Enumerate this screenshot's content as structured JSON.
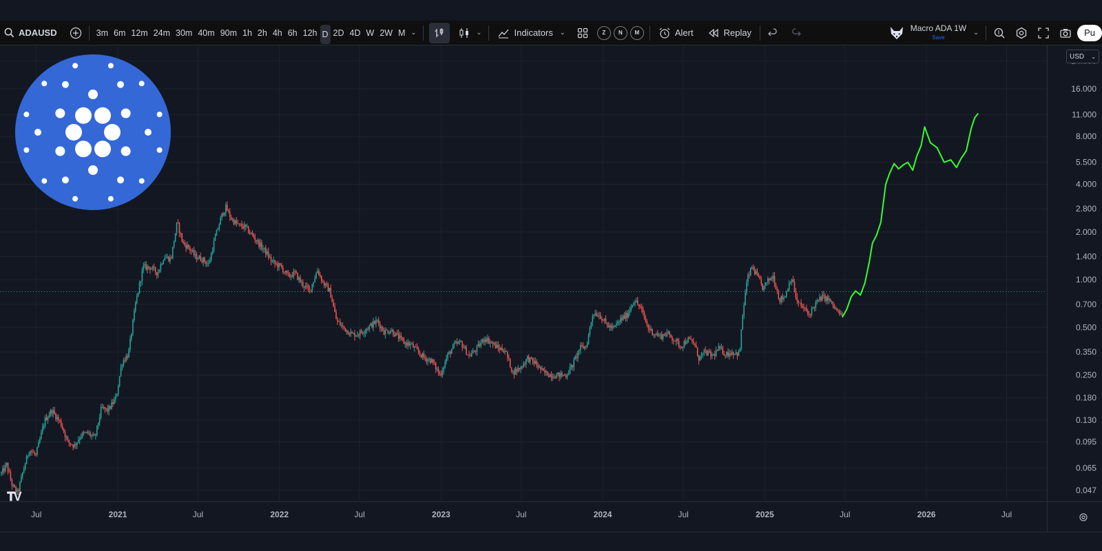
{
  "toolbar": {
    "symbol": "ADAUSD",
    "timeframes": [
      {
        "label": "3m",
        "active": false
      },
      {
        "label": "6m",
        "active": false
      },
      {
        "label": "12m",
        "active": false
      },
      {
        "label": "24m",
        "active": false
      },
      {
        "label": "30m",
        "active": false
      },
      {
        "label": "40m",
        "active": false
      },
      {
        "label": "90m",
        "active": false
      },
      {
        "label": "1h",
        "active": false
      },
      {
        "label": "2h",
        "active": false
      },
      {
        "label": "4h",
        "active": false
      },
      {
        "label": "6h",
        "active": false
      },
      {
        "label": "12h",
        "active": false
      },
      {
        "label": "D",
        "active": true
      },
      {
        "label": "2D",
        "active": false
      },
      {
        "label": "4D",
        "active": false
      },
      {
        "label": "W",
        "active": false
      },
      {
        "label": "2W",
        "active": false
      },
      {
        "label": "M",
        "active": false
      }
    ],
    "indicators_label": "Indicators",
    "session_buttons": [
      "Z",
      "N",
      "M"
    ],
    "alert_label": "Alert",
    "replay_label": "Replay",
    "layout_name": "Macro ADA 1W",
    "layout_save": "Save",
    "publish_label": "Pu"
  },
  "currency": "USD",
  "colors": {
    "background": "#131722",
    "toolbar": "#0f0f0f",
    "grid": "#1e222d",
    "up": "#26a69a",
    "down": "#ef5350",
    "projection": "#33ff33",
    "price_line": "#26a69a",
    "logo_blue": "#3468d6"
  },
  "icons": {
    "search": "search-icon",
    "compare": "add-circle-icon",
    "chart_type": "candles-icon",
    "indicators": "indicators-icon",
    "templates": "grid-icon",
    "alert": "alarm-clock-icon",
    "replay": "rewind-icon",
    "undo": "undo-icon",
    "redo": "redo-icon",
    "avatar": "fox-avatar-icon",
    "zoom": "magnifier-icon",
    "settings": "gear-icon",
    "fullscreen": "fullscreen-icon",
    "snapshot": "camera-icon",
    "cardano_logo": "cardano-logo-icon",
    "tradingview_logo": "tradingview-logo-icon"
  },
  "chart_data": {
    "type": "line",
    "y_scale": "log",
    "ylim": [
      0.04,
      30
    ],
    "xlim": [
      "2020-04-10",
      "2026-09-30"
    ],
    "y_ticks": [
      "24.000",
      "16.000",
      "11.000",
      "8.000",
      "5.500",
      "4.000",
      "2.800",
      "2.000",
      "1.400",
      "1.000",
      "0.700",
      "0.500",
      "0.350",
      "0.250",
      "0.180",
      "0.130",
      "0.095",
      "0.065",
      "0.047"
    ],
    "x_ticks": [
      {
        "date": "2020-07-01",
        "label": "Jul"
      },
      {
        "date": "2021-01-01",
        "label": "2021"
      },
      {
        "date": "2021-07-01",
        "label": "Jul"
      },
      {
        "date": "2022-01-01",
        "label": "2022"
      },
      {
        "date": "2022-07-01",
        "label": "Jul"
      },
      {
        "date": "2023-01-01",
        "label": "2023"
      },
      {
        "date": "2023-07-01",
        "label": "Jul"
      },
      {
        "date": "2024-01-01",
        "label": "2024"
      },
      {
        "date": "2024-07-01",
        "label": "Jul"
      },
      {
        "date": "2025-01-01",
        "label": "2025"
      },
      {
        "date": "2025-07-01",
        "label": "Jul"
      },
      {
        "date": "2026-01-01",
        "label": "2026"
      },
      {
        "date": "2026-07-01",
        "label": "Jul"
      }
    ],
    "price_line": 0.84,
    "series": [
      {
        "name": "ADAUSD",
        "style": "candles",
        "points": [
          [
            "2020-04-13",
            0.06
          ],
          [
            "2020-04-25",
            0.068
          ],
          [
            "2020-05-08",
            0.05
          ],
          [
            "2020-05-20",
            0.045
          ],
          [
            "2020-06-01",
            0.062
          ],
          [
            "2020-06-15",
            0.085
          ],
          [
            "2020-06-30",
            0.078
          ],
          [
            "2020-07-20",
            0.13
          ],
          [
            "2020-08-05",
            0.15
          ],
          [
            "2020-08-25",
            0.125
          ],
          [
            "2020-09-10",
            0.095
          ],
          [
            "2020-09-25",
            0.09
          ],
          [
            "2020-10-10",
            0.105
          ],
          [
            "2020-10-25",
            0.108
          ],
          [
            "2020-11-10",
            0.1
          ],
          [
            "2020-11-25",
            0.155
          ],
          [
            "2020-12-10",
            0.15
          ],
          [
            "2020-12-28",
            0.18
          ],
          [
            "2021-01-10",
            0.3
          ],
          [
            "2021-01-25",
            0.34
          ],
          [
            "2021-02-10",
            0.7
          ],
          [
            "2021-02-27",
            1.2
          ],
          [
            "2021-03-15",
            1.2
          ],
          [
            "2021-04-01",
            1.1
          ],
          [
            "2021-04-15",
            1.4
          ],
          [
            "2021-05-01",
            1.35
          ],
          [
            "2021-05-15",
            2.3
          ],
          [
            "2021-05-28",
            1.7
          ],
          [
            "2021-06-10",
            1.6
          ],
          [
            "2021-06-25",
            1.4
          ],
          [
            "2021-07-10",
            1.35
          ],
          [
            "2021-07-25",
            1.25
          ],
          [
            "2021-08-10",
            1.9
          ],
          [
            "2021-08-25",
            2.6
          ],
          [
            "2021-09-02",
            2.85
          ],
          [
            "2021-09-15",
            2.4
          ],
          [
            "2021-10-01",
            2.2
          ],
          [
            "2021-10-15",
            2.15
          ],
          [
            "2021-11-01",
            1.9
          ],
          [
            "2021-11-15",
            1.7
          ],
          [
            "2021-12-01",
            1.5
          ],
          [
            "2021-12-15",
            1.3
          ],
          [
            "2022-01-05",
            1.2
          ],
          [
            "2022-01-20",
            1.05
          ],
          [
            "2022-02-05",
            1.1
          ],
          [
            "2022-02-20",
            0.95
          ],
          [
            "2022-03-10",
            0.85
          ],
          [
            "2022-03-28",
            1.15
          ],
          [
            "2022-04-10",
            0.95
          ],
          [
            "2022-04-25",
            0.85
          ],
          [
            "2022-05-10",
            0.55
          ],
          [
            "2022-05-25",
            0.5
          ],
          [
            "2022-06-15",
            0.45
          ],
          [
            "2022-07-01",
            0.46
          ],
          [
            "2022-07-20",
            0.5
          ],
          [
            "2022-08-10",
            0.55
          ],
          [
            "2022-08-25",
            0.47
          ],
          [
            "2022-09-10",
            0.48
          ],
          [
            "2022-09-25",
            0.44
          ],
          [
            "2022-10-10",
            0.4
          ],
          [
            "2022-10-25",
            0.39
          ],
          [
            "2022-11-10",
            0.35
          ],
          [
            "2022-11-25",
            0.32
          ],
          [
            "2022-12-10",
            0.31
          ],
          [
            "2022-12-30",
            0.25
          ],
          [
            "2023-01-15",
            0.33
          ],
          [
            "2023-02-01",
            0.39
          ],
          [
            "2023-02-15",
            0.4
          ],
          [
            "2023-03-05",
            0.33
          ],
          [
            "2023-03-20",
            0.36
          ],
          [
            "2023-04-10",
            0.43
          ],
          [
            "2023-04-25",
            0.4
          ],
          [
            "2023-05-10",
            0.37
          ],
          [
            "2023-05-25",
            0.36
          ],
          [
            "2023-06-12",
            0.26
          ],
          [
            "2023-06-30",
            0.28
          ],
          [
            "2023-07-15",
            0.32
          ],
          [
            "2023-08-01",
            0.3
          ],
          [
            "2023-08-20",
            0.26
          ],
          [
            "2023-09-10",
            0.25
          ],
          [
            "2023-09-25",
            0.25
          ],
          [
            "2023-10-10",
            0.25
          ],
          [
            "2023-10-25",
            0.29
          ],
          [
            "2023-11-10",
            0.37
          ],
          [
            "2023-11-25",
            0.38
          ],
          [
            "2023-12-10",
            0.62
          ],
          [
            "2023-12-25",
            0.6
          ],
          [
            "2024-01-10",
            0.52
          ],
          [
            "2024-01-25",
            0.49
          ],
          [
            "2024-02-10",
            0.56
          ],
          [
            "2024-02-25",
            0.6
          ],
          [
            "2024-03-12",
            0.75
          ],
          [
            "2024-03-28",
            0.65
          ],
          [
            "2024-04-12",
            0.5
          ],
          [
            "2024-04-25",
            0.46
          ],
          [
            "2024-05-10",
            0.44
          ],
          [
            "2024-05-25",
            0.46
          ],
          [
            "2024-06-10",
            0.42
          ],
          [
            "2024-06-25",
            0.38
          ],
          [
            "2024-07-10",
            0.42
          ],
          [
            "2024-07-25",
            0.4
          ],
          [
            "2024-08-05",
            0.32
          ],
          [
            "2024-08-20",
            0.35
          ],
          [
            "2024-09-05",
            0.33
          ],
          [
            "2024-09-20",
            0.37
          ],
          [
            "2024-10-05",
            0.34
          ],
          [
            "2024-10-20",
            0.35
          ],
          [
            "2024-11-05",
            0.34
          ],
          [
            "2024-11-12",
            0.6
          ],
          [
            "2024-11-22",
            1.0
          ],
          [
            "2024-12-03",
            1.2
          ],
          [
            "2024-12-15",
            1.05
          ],
          [
            "2024-12-28",
            0.88
          ],
          [
            "2025-01-10",
            1.0
          ],
          [
            "2025-01-20",
            1.05
          ],
          [
            "2025-02-03",
            0.75
          ],
          [
            "2025-02-15",
            0.78
          ],
          [
            "2025-03-02",
            1.05
          ],
          [
            "2025-03-15",
            0.72
          ],
          [
            "2025-03-30",
            0.66
          ],
          [
            "2025-04-10",
            0.6
          ],
          [
            "2025-04-25",
            0.7
          ],
          [
            "2025-05-10",
            0.78
          ],
          [
            "2025-05-25",
            0.75
          ],
          [
            "2025-06-10",
            0.65
          ],
          [
            "2025-06-25",
            0.58
          ]
        ]
      },
      {
        "name": "Projection",
        "style": "line",
        "points": [
          [
            "2025-06-25",
            0.58
          ],
          [
            "2025-07-05",
            0.65
          ],
          [
            "2025-07-15",
            0.78
          ],
          [
            "2025-07-25",
            0.85
          ],
          [
            "2025-08-05",
            0.8
          ],
          [
            "2025-08-15",
            0.95
          ],
          [
            "2025-08-25",
            1.3
          ],
          [
            "2025-09-01",
            1.7
          ],
          [
            "2025-09-10",
            1.9
          ],
          [
            "2025-09-20",
            2.3
          ],
          [
            "2025-10-01",
            4.0
          ],
          [
            "2025-10-10",
            4.7
          ],
          [
            "2025-10-20",
            5.4
          ],
          [
            "2025-10-30",
            5.0
          ],
          [
            "2025-11-10",
            5.3
          ],
          [
            "2025-11-20",
            5.5
          ],
          [
            "2025-12-01",
            4.9
          ],
          [
            "2025-12-10",
            6.0
          ],
          [
            "2025-12-20",
            7.0
          ],
          [
            "2025-12-28",
            9.2
          ],
          [
            "2026-01-10",
            7.3
          ],
          [
            "2026-01-25",
            6.8
          ],
          [
            "2026-02-10",
            5.5
          ],
          [
            "2026-02-25",
            5.7
          ],
          [
            "2026-03-10",
            5.1
          ],
          [
            "2026-03-20",
            5.8
          ],
          [
            "2026-04-01",
            6.5
          ],
          [
            "2026-04-12",
            9.0
          ],
          [
            "2026-04-20",
            10.5
          ],
          [
            "2026-04-28",
            11.2
          ]
        ]
      }
    ]
  }
}
